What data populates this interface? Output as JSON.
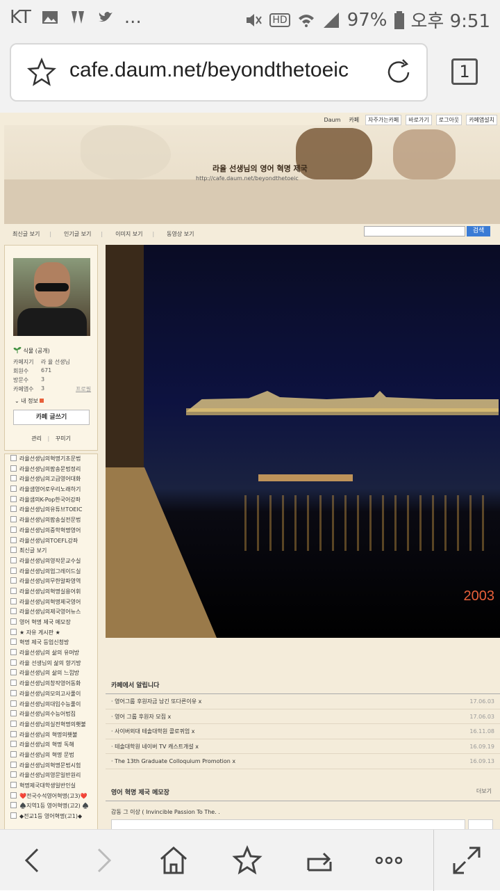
{
  "status": {
    "carrier": "KT",
    "battery": "97%",
    "time": "오후 9:51",
    "notification_more": "...",
    "hd_badge": "HD"
  },
  "browser": {
    "url": "cafe.daum.net/beyondthetoeic",
    "tab_count": "1"
  },
  "cafe_topnav": {
    "items": [
      "Daum",
      "카페",
      "자주가는카페",
      "바로가기",
      "로그아웃",
      "카페앱설치"
    ]
  },
  "banner": {
    "title": "라율 선생님의 영어 혁명 제국",
    "url": "http://cafe.daum.net/beyondthetoeic"
  },
  "menu": {
    "items": [
      "최신글 보기",
      "인기글 보기",
      "이미지 보기",
      "동영상 보기"
    ],
    "search_button": "검색"
  },
  "profile": {
    "level_name": "식물 (공개)",
    "rows": [
      {
        "label": "카페지기",
        "value": "라 율 선생님",
        "extra": ""
      },
      {
        "label": "회원수",
        "value": "671",
        "extra": ""
      },
      {
        "label": "방문수",
        "value": "3",
        "extra": ""
      },
      {
        "label": "카페앱수",
        "value": "3",
        "extra": "프로필"
      }
    ],
    "my_info": "내 정보",
    "write_button": "카페 글쓰기",
    "admin_link": "관리",
    "decorate_link": "꾸미기"
  },
  "boards": [
    "라율선생님의혁명기초문법",
    "라율선생님의팝송문법정리",
    "라율선생님의고급영어대화",
    "라율샘영어로우리노래하기",
    "라율샘의K-Pop한국어강좌",
    "라율선생님의유튜브TOEIC",
    "라율선생님의팝송실전문법",
    "라율선생님의중학혁명영어",
    "라율선생님의TOEFL강좌",
    "최신글 보기",
    "라율선생님의영작문교수실",
    "라율선생님의업그레이드실",
    "라율선생님의무한알파영역",
    "라율선생님의혁명실용어휘",
    "라율선생님의혁명제국영어",
    "라율선생님의제국영어뉴스",
    "영어 혁명 제국 메모장",
    "★ 자유 게시판 ★",
    "혁명 제국 등업신청방",
    "라율선생님의 삶의 유머방",
    "라율 선생님의 삶의 향기방",
    "라율선생님의 삶의 느낌방",
    "라율선생님의창작영어동화",
    "라율선생님의모의고사풀이",
    "라율선생님의대입수능풀이",
    "라율선생님의수능어법집",
    "라율선생님의실전혁명의횃불",
    "라율선생님의 혁명의횃불",
    "라율선생님의 혁명 독해",
    "라율선생님의 혁명 문법",
    "라율선생님의혁명문법시험",
    "라율선생님의영문일반원리",
    "혁명제국대학생일반인실",
    "❤️전국수석영어혁명(고3)❤️",
    "♠️지역1등 영어혁명(고2) ♠️",
    "◆전교1등 영어혁명(고1)◆"
  ],
  "photo": {
    "year_stamp": "2003"
  },
  "notice": {
    "title": "카페에서 알립니다",
    "rows": [
      {
        "text": "영어그룹 후원자금 남긴 또다른이유 x",
        "date": "17.06.03"
      },
      {
        "text": "영어 그룹 후원자 모집 x",
        "date": "17.06.03"
      },
      {
        "text": "사이버외대 테솔대학원 콜로퀴엄 x",
        "date": "16.11.08"
      },
      {
        "text": "테솔대학원 네이버 TV 캐스트개설 x",
        "date": "16.09.19"
      },
      {
        "text": "The 13th Graduate Colloquium Promotion x",
        "date": "16.09.13"
      }
    ]
  },
  "memo": {
    "title": "영어 혁명 제국 메모장",
    "more": "더보기",
    "text": "감동 그 이상 ( Invincible Passion To The. ."
  },
  "colors": {
    "page_bg": "#f4ecda",
    "search_btn": "#3a7bd5",
    "year_stamp": "#e8603a"
  }
}
